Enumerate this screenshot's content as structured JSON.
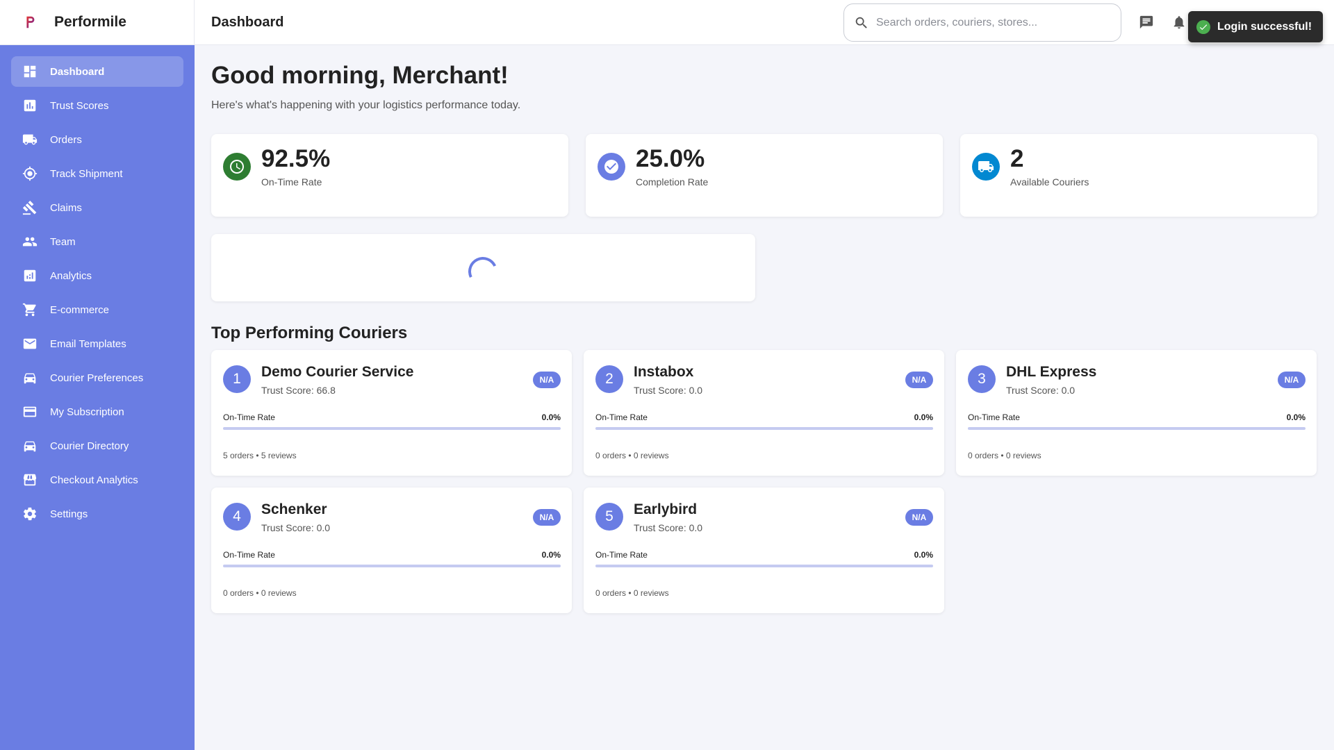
{
  "brand": {
    "name": "Performile"
  },
  "header": {
    "title": "Dashboard",
    "search_placeholder": "Search orders, couriers, stores..."
  },
  "toast": {
    "message": "Login successful!"
  },
  "sidebar": {
    "items": [
      {
        "label": "Dashboard",
        "icon": "dashboard-icon",
        "active": true
      },
      {
        "label": "Trust Scores",
        "icon": "bar-chart-icon"
      },
      {
        "label": "Orders",
        "icon": "truck-icon"
      },
      {
        "label": "Track Shipment",
        "icon": "gps-target-icon"
      },
      {
        "label": "Claims",
        "icon": "gavel-icon"
      },
      {
        "label": "Team",
        "icon": "people-icon"
      },
      {
        "label": "Analytics",
        "icon": "analytics-icon"
      },
      {
        "label": "E-commerce",
        "icon": "cart-icon"
      },
      {
        "label": "Email Templates",
        "icon": "mail-icon"
      },
      {
        "label": "Courier Preferences",
        "icon": "car-icon"
      },
      {
        "label": "My Subscription",
        "icon": "credit-card-icon"
      },
      {
        "label": "Courier Directory",
        "icon": "car-icon"
      },
      {
        "label": "Checkout Analytics",
        "icon": "storefront-icon"
      },
      {
        "label": "Settings",
        "icon": "gear-icon"
      }
    ]
  },
  "main": {
    "greeting": "Good morning, Merchant!",
    "subtitle": "Here's what's happening with your logistics performance today.",
    "stats": [
      {
        "value": "92.5%",
        "label": "On-Time Rate",
        "icon": "clock-icon",
        "color": "#2e7d32"
      },
      {
        "value": "25.0%",
        "label": "Completion Rate",
        "icon": "check-circle-icon",
        "color": "#6a7de3"
      },
      {
        "value": "2",
        "label": "Available Couriers",
        "icon": "truck-icon",
        "color": "#0288d1"
      }
    ],
    "section_title": "Top Performing Couriers",
    "couriers": [
      {
        "rank": "1",
        "name": "Demo Courier Service",
        "trust": "Trust Score: 66.8",
        "badge": "N/A",
        "metric_label": "On-Time Rate",
        "metric_value": "0.0%",
        "progress": 0,
        "footer": "5 orders • 5 reviews"
      },
      {
        "rank": "2",
        "name": "Instabox",
        "trust": "Trust Score: 0.0",
        "badge": "N/A",
        "metric_label": "On-Time Rate",
        "metric_value": "0.0%",
        "progress": 0,
        "footer": "0 orders • 0 reviews"
      },
      {
        "rank": "3",
        "name": "DHL Express",
        "trust": "Trust Score: 0.0",
        "badge": "N/A",
        "metric_label": "On-Time Rate",
        "metric_value": "0.0%",
        "progress": 0,
        "footer": "0 orders • 0 reviews"
      },
      {
        "rank": "4",
        "name": "Schenker",
        "trust": "Trust Score: 0.0",
        "badge": "N/A",
        "metric_label": "On-Time Rate",
        "metric_value": "0.0%",
        "progress": 0,
        "footer": "0 orders • 0 reviews"
      },
      {
        "rank": "5",
        "name": "Earlybird",
        "trust": "Trust Score: 0.0",
        "badge": "N/A",
        "metric_label": "On-Time Rate",
        "metric_value": "0.0%",
        "progress": 0,
        "footer": "0 orders • 0 reviews"
      }
    ]
  },
  "colors": {
    "accent": "#6a7de3",
    "sidebar": "#6a7de3",
    "success": "#4caf50"
  }
}
